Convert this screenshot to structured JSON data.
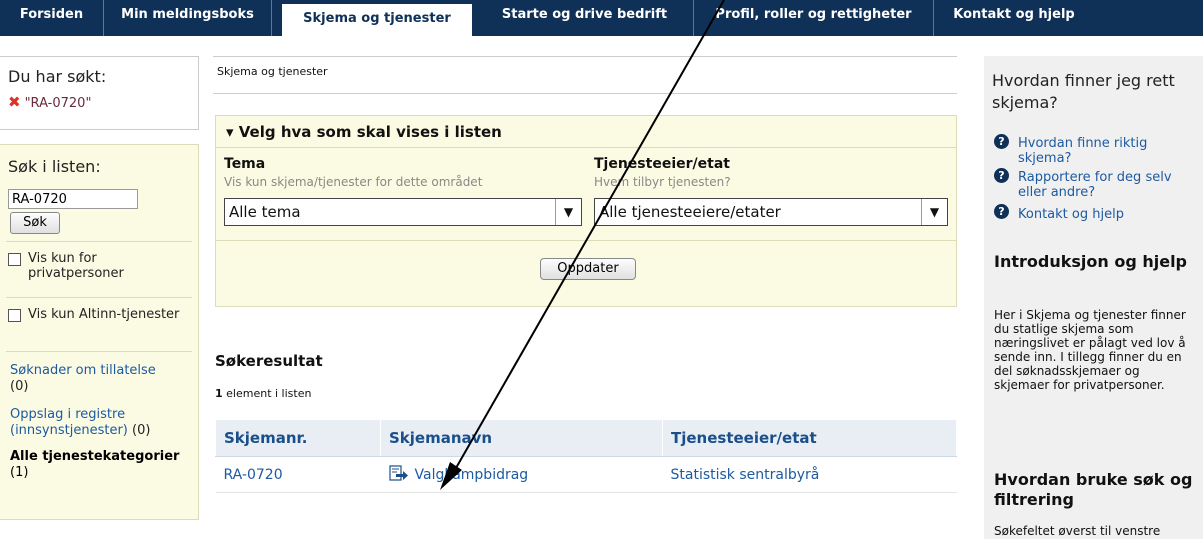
{
  "topnav": {
    "tabs": [
      {
        "label": "Forsiden"
      },
      {
        "label": "Min meldingsboks"
      },
      {
        "label": "Skjema og tjenester"
      },
      {
        "label": "Starte og drive bedrift"
      },
      {
        "label": "Profil, roller og rettigheter"
      },
      {
        "label": "Kontakt og hjelp"
      }
    ]
  },
  "left": {
    "searched_heading": "Du har søkt:",
    "search_term": "\"RA-0720\"",
    "search_list_title": "Søk i listen:",
    "search_value": "RA-0720",
    "search_button": "Søk",
    "checkboxes": [
      {
        "label": "Vis kun for privatpersoner"
      },
      {
        "label": "Vis kun Altinn-tjenester"
      }
    ],
    "categories": [
      {
        "label": "Søknader om tillatelse",
        "count": "(0)"
      },
      {
        "label": "Oppslag i registre (innsynstjenester)",
        "count": "(0)"
      }
    ],
    "all_categories": {
      "label": "Alle tjenestekategorier",
      "count": "(1)"
    }
  },
  "main": {
    "breadcrumb": "Skjema og tjenester",
    "filter": {
      "heading": "▾ Velg hva som skal vises i listen",
      "tema_label": "Tema",
      "tema_sub": "Vis kun skjema/tjenester for dette området",
      "tema_value": "Alle tema",
      "etat_label": "Tjenesteeier/etat",
      "etat_sub": "Hvem tilbyr tjenesten?",
      "etat_value": "Alle tjenesteeiere/etater",
      "update_button": "Oppdater"
    },
    "results": {
      "title": "Søkeresultat",
      "count_num": "1",
      "count_text": " element i listen",
      "columns": [
        "Skjemanr.",
        "Skjemanavn",
        "Tjenesteeier/etat"
      ],
      "rows": [
        {
          "nr": "RA-0720",
          "name": "Valgkampbidrag",
          "owner": "Statistisk sentralbyrå"
        }
      ]
    }
  },
  "right": {
    "question": "Hvordan finner jeg rett skjema?",
    "help_links": [
      {
        "label": "Hvordan finne riktig skjema?"
      },
      {
        "label": "Rapportere for deg selv eller andre?"
      },
      {
        "label": "Kontakt og hjelp"
      }
    ],
    "intro_heading": "Introduksjon og hjelp",
    "intro_text": "Her i Skjema og tjenester finner du statlige skjema som næringslivet er pålagt ved lov å sende inn. I tillegg finner du en del søknadsskjemaer og skjemaer for privatpersoner.",
    "howto_heading": "Hvordan bruke søk og filtrering",
    "howto_text": "Søkefeltet øverst til venstre"
  },
  "colors": {
    "nav_bg": "#0f3057",
    "link": "#1d5aa0",
    "panel_bg": "#fbfbe4",
    "table_header_bg": "#e8eef4"
  }
}
